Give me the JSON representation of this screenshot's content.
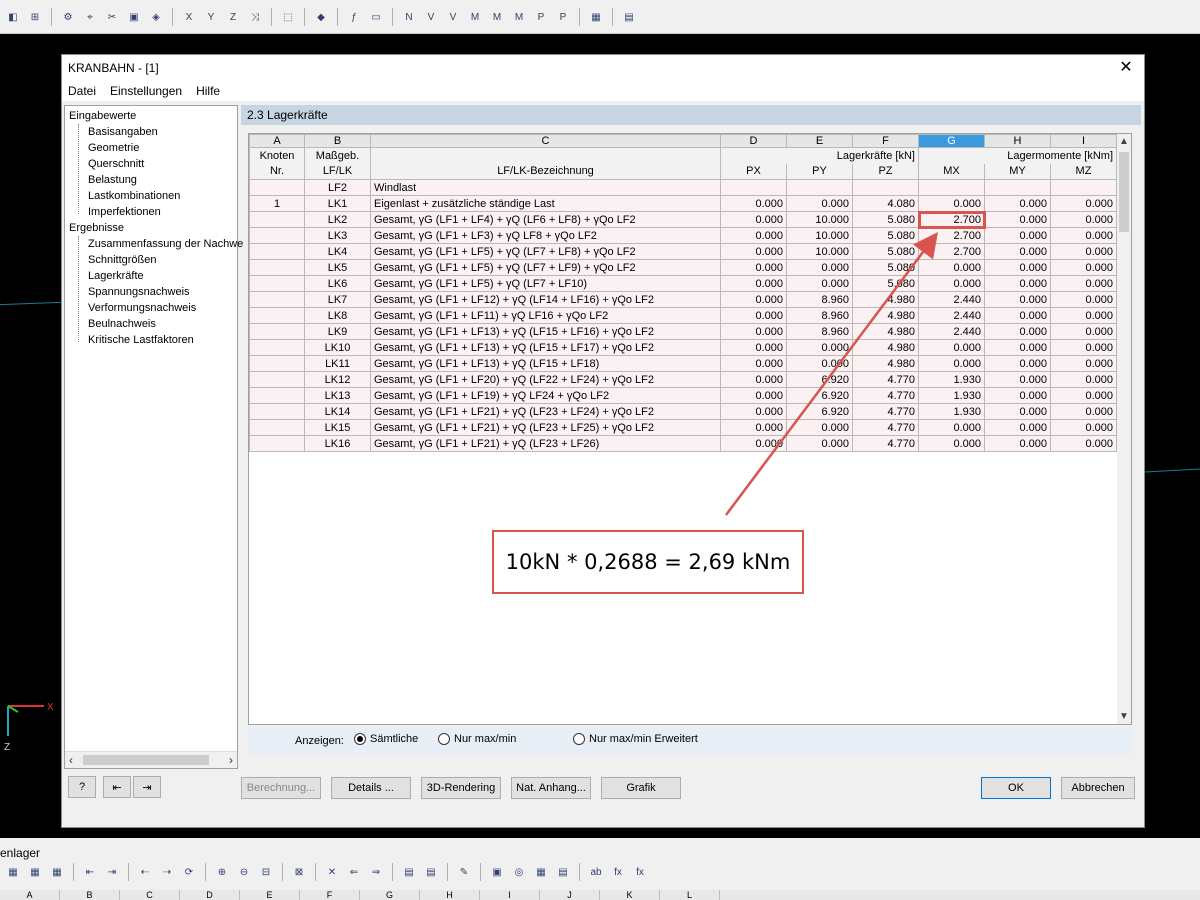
{
  "dialog": {
    "title": "KRANBAHN - [1]",
    "close_glyph": "✕",
    "menu": [
      "Datei",
      "Einstellungen",
      "Hilfe"
    ]
  },
  "nav": {
    "sections": [
      {
        "label": "Eingabewerte",
        "items": [
          "Basisangaben",
          "Geometrie",
          "Querschnitt",
          "Belastung",
          "Lastkombinationen",
          "Imperfektionen"
        ]
      },
      {
        "label": "Ergebnisse",
        "items": [
          "Zusammenfassung der Nachwe",
          "Schnittgrößen",
          "Lagerkräfte",
          "Spannungsnachweis",
          "Verformungsnachweis",
          "Beulnachweis",
          "Kritische Lastfaktoren"
        ]
      }
    ]
  },
  "panel": {
    "title": "2.3 Lagerkräfte"
  },
  "table": {
    "col_letters": [
      "A",
      "B",
      "C",
      "D",
      "E",
      "F",
      "G",
      "H",
      "I"
    ],
    "selected_col": "G",
    "hdr1": [
      "Knoten",
      "Maßgeb.",
      "",
      "Lagerkräfte [kN]",
      "Lagermomente [kNm]"
    ],
    "hdr2": [
      "Nr.",
      "LF/LK",
      "LF/LK-Bezeichnung",
      "PX",
      "PY",
      "PZ",
      "MX",
      "MY",
      "MZ"
    ],
    "rows": [
      [
        "",
        "LF2",
        "Windlast",
        "",
        "",
        "",
        "",
        "",
        ""
      ],
      [
        "1",
        "LK1",
        "Eigenlast + zusätzliche ständige Last",
        "0.000",
        "0.000",
        "4.080",
        "0.000",
        "0.000",
        "0.000"
      ],
      [
        "",
        "LK2",
        "Gesamt, γG (LF1 + LF4) + γQ (LF6 + LF8) + γQo LF2",
        "0.000",
        "10.000",
        "5.080",
        "2.700",
        "0.000",
        "0.000"
      ],
      [
        "",
        "LK3",
        "Gesamt, γG (LF1 + LF3) + γQ LF8 + γQo LF2",
        "0.000",
        "10.000",
        "5.080",
        "2.700",
        "0.000",
        "0.000"
      ],
      [
        "",
        "LK4",
        "Gesamt, γG (LF1 + LF5) + γQ (LF7 + LF8) + γQo LF2",
        "0.000",
        "10.000",
        "5.080",
        "2.700",
        "0.000",
        "0.000"
      ],
      [
        "",
        "LK5",
        "Gesamt, γG (LF1 + LF5) + γQ (LF7 + LF9) + γQo LF2",
        "0.000",
        "0.000",
        "5.080",
        "0.000",
        "0.000",
        "0.000"
      ],
      [
        "",
        "LK6",
        "Gesamt, γG (LF1 + LF5) + γQ (LF7 + LF10)",
        "0.000",
        "0.000",
        "5.080",
        "0.000",
        "0.000",
        "0.000"
      ],
      [
        "",
        "LK7",
        "Gesamt, γG (LF1 + LF12) + γQ (LF14 + LF16) + γQo LF2",
        "0.000",
        "8.960",
        "4.980",
        "2.440",
        "0.000",
        "0.000"
      ],
      [
        "",
        "LK8",
        "Gesamt, γG (LF1 + LF11) + γQ LF16 + γQo LF2",
        "0.000",
        "8.960",
        "4.980",
        "2.440",
        "0.000",
        "0.000"
      ],
      [
        "",
        "LK9",
        "Gesamt, γG (LF1 + LF13) + γQ (LF15 + LF16) + γQo LF2",
        "0.000",
        "8.960",
        "4.980",
        "2.440",
        "0.000",
        "0.000"
      ],
      [
        "",
        "LK10",
        "Gesamt, γG (LF1 + LF13) + γQ (LF15 + LF17) + γQo LF2",
        "0.000",
        "0.000",
        "4.980",
        "0.000",
        "0.000",
        "0.000"
      ],
      [
        "",
        "LK11",
        "Gesamt, γG (LF1 + LF13) + γQ (LF15 + LF18)",
        "0.000",
        "0.000",
        "4.980",
        "0.000",
        "0.000",
        "0.000"
      ],
      [
        "",
        "LK12",
        "Gesamt, γG (LF1 + LF20) + γQ (LF22 + LF24) + γQo LF2",
        "0.000",
        "6.920",
        "4.770",
        "1.930",
        "0.000",
        "0.000"
      ],
      [
        "",
        "LK13",
        "Gesamt, γG (LF1 + LF19) + γQ LF24 + γQo LF2",
        "0.000",
        "6.920",
        "4.770",
        "1.930",
        "0.000",
        "0.000"
      ],
      [
        "",
        "LK14",
        "Gesamt, γG (LF1 + LF21) + γQ (LF23 + LF24) + γQo LF2",
        "0.000",
        "6.920",
        "4.770",
        "1.930",
        "0.000",
        "0.000"
      ],
      [
        "",
        "LK15",
        "Gesamt, γG (LF1 + LF21) + γQ (LF23 + LF25) + γQo LF2",
        "0.000",
        "0.000",
        "4.770",
        "0.000",
        "0.000",
        "0.000"
      ],
      [
        "",
        "LK16",
        "Gesamt, γG (LF1 + LF21) + γQ (LF23 + LF26)",
        "0.000",
        "0.000",
        "4.770",
        "0.000",
        "0.000",
        "0.000"
      ]
    ],
    "highlight_row": 2,
    "highlight_col": 6
  },
  "filter": {
    "label": "Anzeigen:",
    "options": [
      "Sämtliche",
      "Nur max/min",
      "Nur max/min Erweitert"
    ],
    "selected": 0
  },
  "buttons": {
    "berechnung": "Berechnung...",
    "details": "Details ...",
    "rendering": "3D-Rendering",
    "anhang": "Nat. Anhang...",
    "grafik": "Grafik",
    "ok": "OK",
    "abbrechen": "Abbrechen"
  },
  "annotation": {
    "text": "10kN * 0,2688 = 2,69 kNm",
    "color": "#d9534f"
  },
  "background": {
    "bottom_panel_title": "enlager",
    "sheet_cols": [
      "A",
      "B",
      "C",
      "D",
      "E",
      "F",
      "G",
      "H",
      "I",
      "J",
      "K",
      "L"
    ],
    "gizmo": {
      "x": "X",
      "z": "Z"
    }
  }
}
